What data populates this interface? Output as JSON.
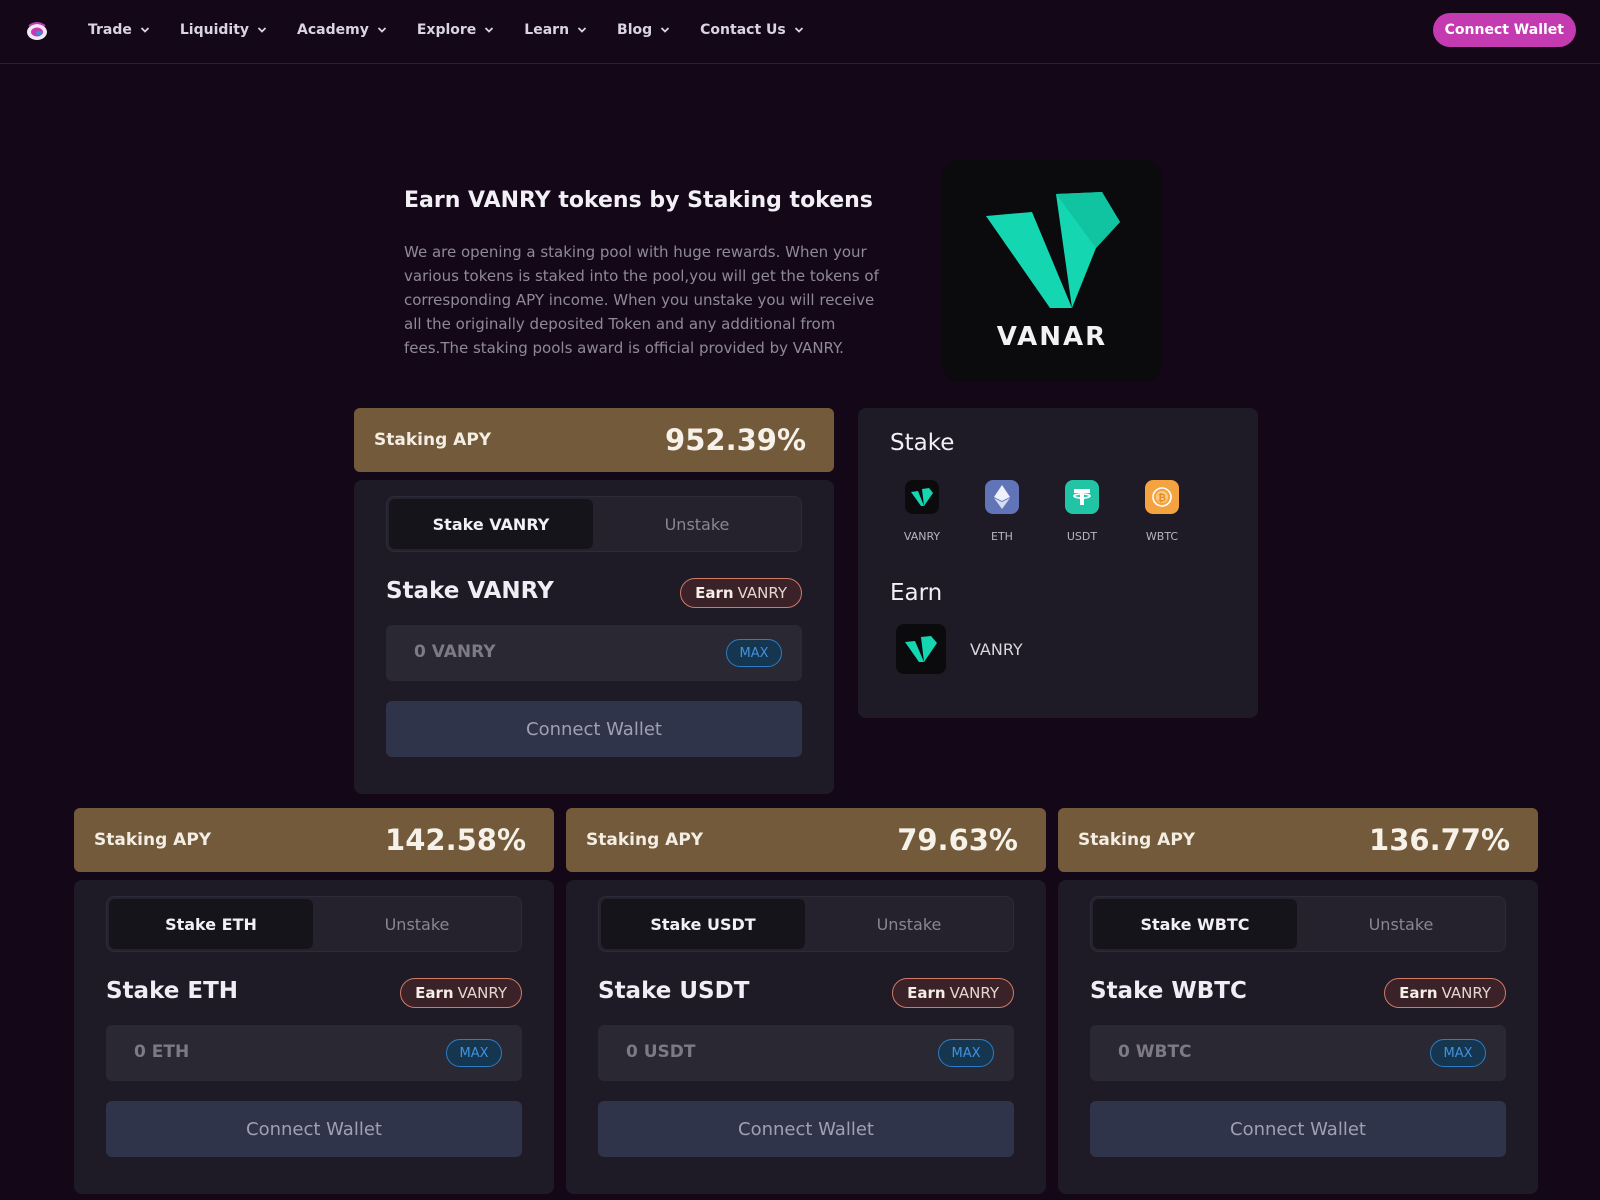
{
  "nav": {
    "items": [
      {
        "label": "Trade"
      },
      {
        "label": "Liquidity"
      },
      {
        "label": "Academy"
      },
      {
        "label": "Explore"
      },
      {
        "label": "Learn"
      },
      {
        "label": "Blog"
      },
      {
        "label": "Contact Us"
      }
    ],
    "connect_label": "Connect Wallet"
  },
  "hero": {
    "title": "Earn VANRY tokens by Staking tokens",
    "description": "We are opening a staking pool with huge rewards. When your various tokens is staked into the pool,you will get the tokens of corresponding APY income. When you unstake you will receive all the originally deposited Token and any additional from fees.The staking pools award is official provided by VANRY.",
    "logo_text": "VANAR"
  },
  "pools": [
    {
      "apy_label": "Staking APY",
      "apy": "952.39%",
      "tab_stake": "Stake VANRY",
      "tab_unstake": "Unstake",
      "title": "Stake VANRY",
      "earn_word": "Earn",
      "earn_token": "VANRY",
      "placeholder": "0 VANRY",
      "max": "MAX",
      "connect": "Connect Wallet"
    },
    {
      "apy_label": "Staking APY",
      "apy": "142.58%",
      "tab_stake": "Stake ETH",
      "tab_unstake": "Unstake",
      "title": "Stake ETH",
      "earn_word": "Earn",
      "earn_token": "VANRY",
      "placeholder": "0 ETH",
      "max": "MAX",
      "connect": "Connect Wallet"
    },
    {
      "apy_label": "Staking APY",
      "apy": "79.63%",
      "tab_stake": "Stake USDT",
      "tab_unstake": "Unstake",
      "title": "Stake USDT",
      "earn_word": "Earn",
      "earn_token": "VANRY",
      "placeholder": "0 USDT",
      "max": "MAX",
      "connect": "Connect Wallet"
    },
    {
      "apy_label": "Staking APY",
      "apy": "136.77%",
      "tab_stake": "Stake WBTC",
      "tab_unstake": "Unstake",
      "title": "Stake WBTC",
      "earn_word": "Earn",
      "earn_token": "VANRY",
      "placeholder": "0 WBTC",
      "max": "MAX",
      "connect": "Connect Wallet"
    }
  ],
  "info": {
    "stake_heading": "Stake",
    "tokens": [
      {
        "name": "VANRY",
        "icon": "vanry-icon",
        "color": "#0b0a0c"
      },
      {
        "name": "ETH",
        "icon": "eth-icon",
        "color": "#6174b8"
      },
      {
        "name": "USDT",
        "icon": "usdt-icon",
        "color": "#22c4a6"
      },
      {
        "name": "WBTC",
        "icon": "wbtc-icon",
        "color": "#f4a340"
      }
    ],
    "earn_heading": "Earn",
    "earn_token": "VANRY"
  },
  "colors": {
    "background": "#140818",
    "accent": "#c43ab0",
    "apy_bar": "#735a3a",
    "card": "#1e1a26",
    "vanar_teal": "#14d6b0"
  }
}
